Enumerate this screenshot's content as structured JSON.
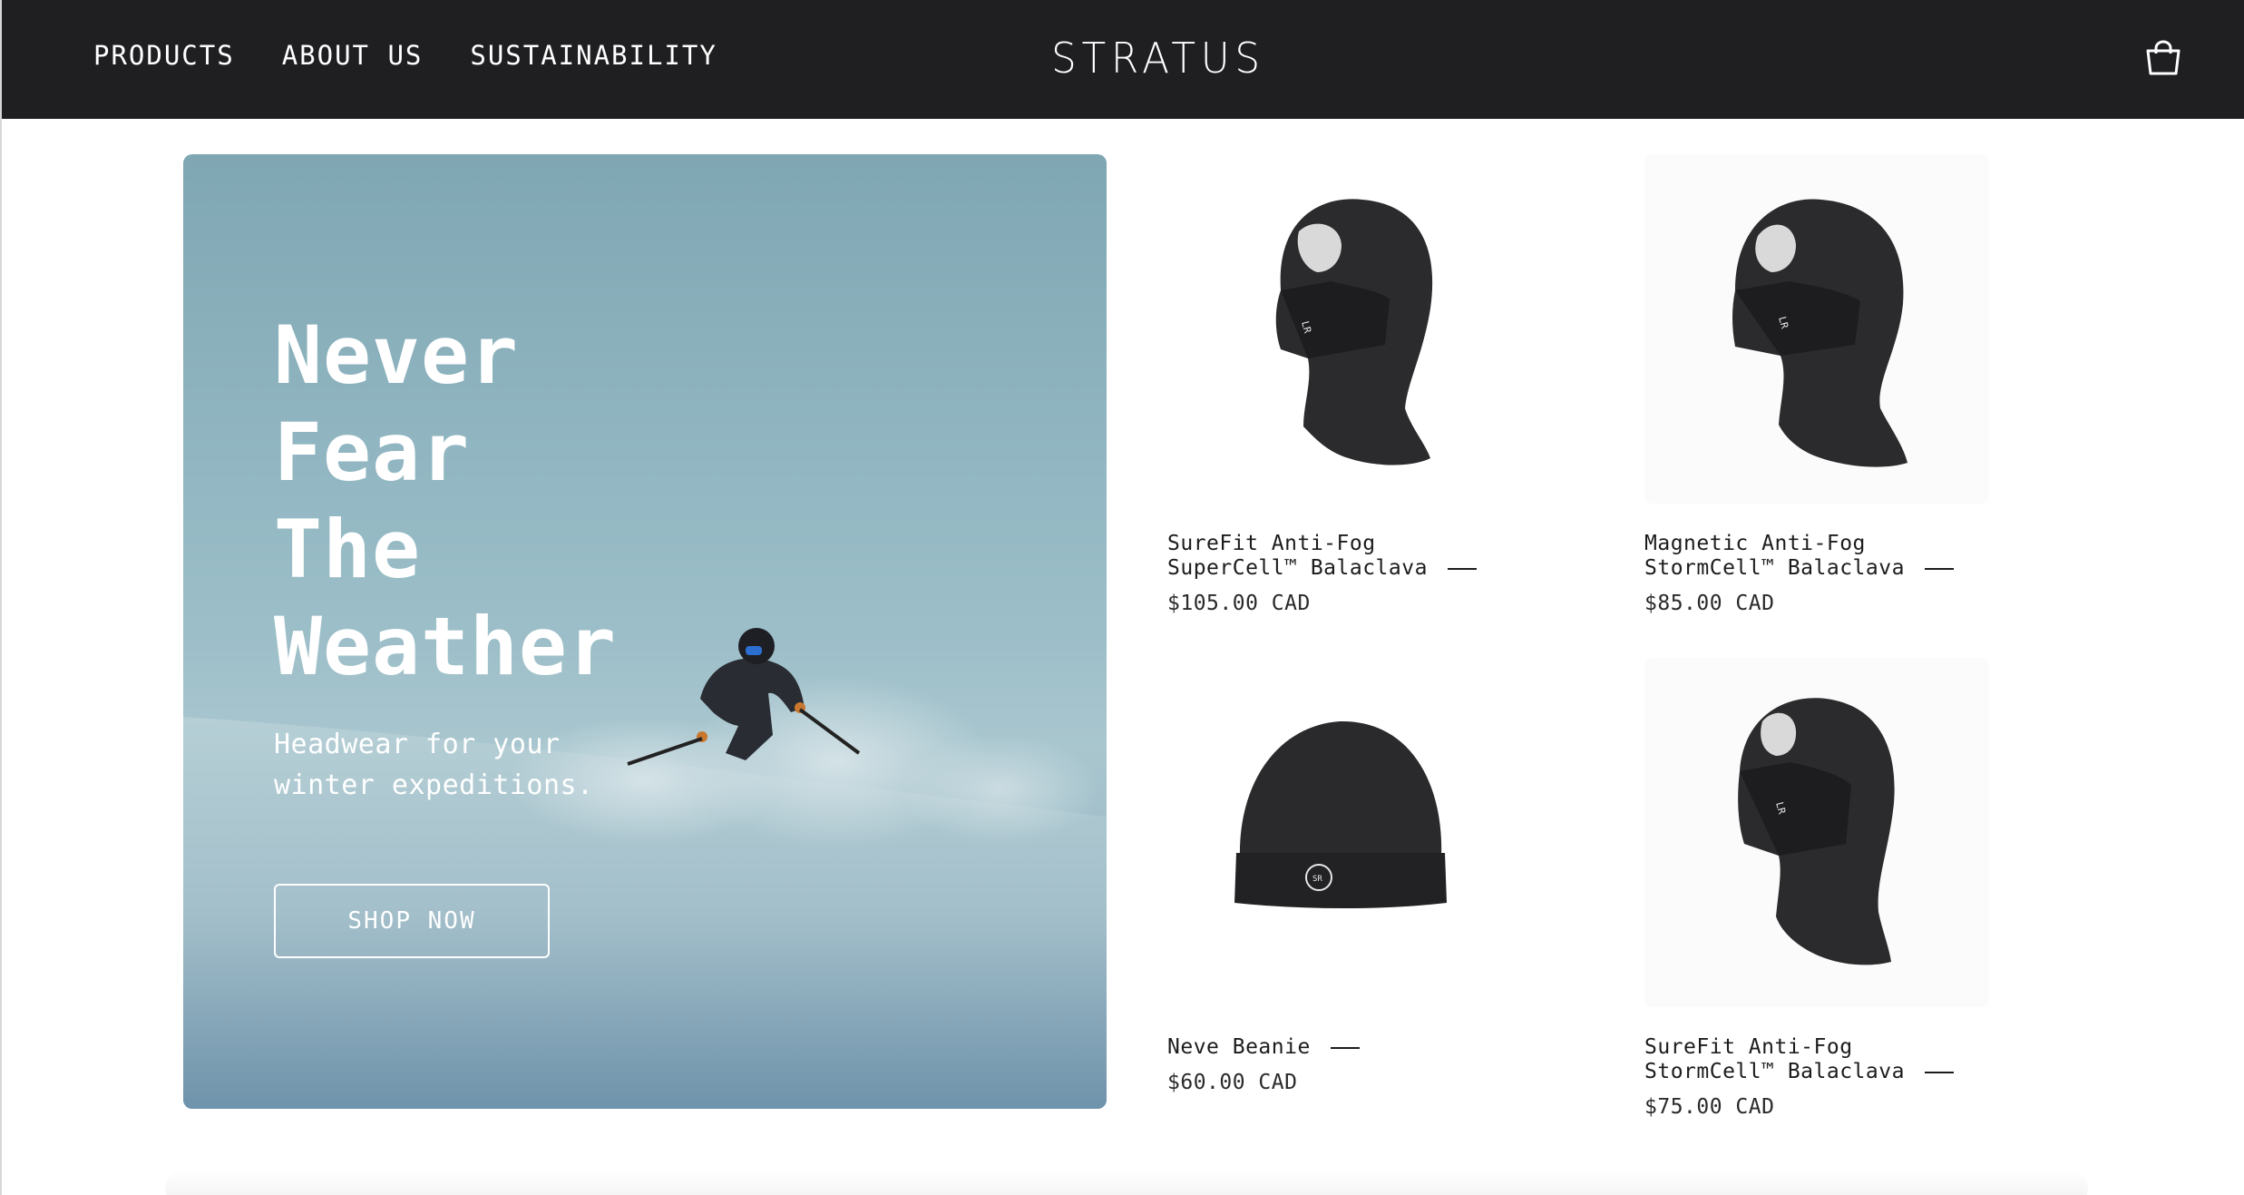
{
  "header": {
    "nav": [
      "PRODUCTS",
      "ABOUT US",
      "SUSTAINABILITY"
    ],
    "logo": "STRATUS",
    "cart_icon": "shopping-bag-icon"
  },
  "hero": {
    "title_lines": [
      "Never",
      "Fear",
      "The",
      "Weather"
    ],
    "subtitle": "Headwear for your winter expeditions.",
    "button_label": "SHOP NOW",
    "image": "skier-in-powder-snow"
  },
  "products": [
    {
      "name_line1": "SureFit Anti-Fog",
      "name_line2": "SuperCell™ Balaclava",
      "price": "$105.00 CAD",
      "image": "black-balaclava-side"
    },
    {
      "name_line1": "Magnetic Anti-Fog",
      "name_line2": "StormCell™ Balaclava",
      "price": "$85.00 CAD",
      "image": "black-balaclava-side"
    },
    {
      "name_line1": "Neve Beanie",
      "name_line2": "",
      "price": "$60.00 CAD",
      "image": "black-beanie"
    },
    {
      "name_line1": "SureFit Anti-Fog",
      "name_line2": "StormCell™ Balaclava",
      "price": "$75.00 CAD",
      "image": "black-balaclava-side"
    }
  ]
}
